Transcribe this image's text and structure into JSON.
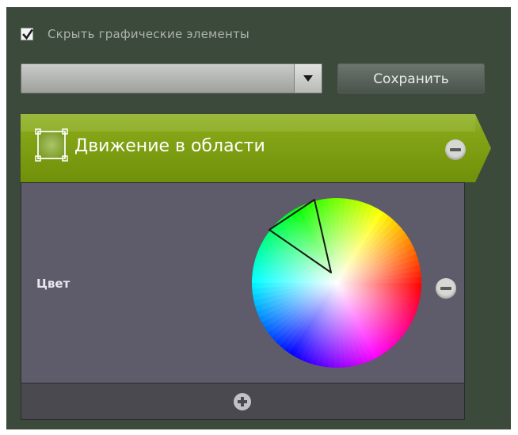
{
  "hide_graphics": {
    "label": "Скрыть графические элементы",
    "checked": true
  },
  "preset_dropdown": {
    "value": ""
  },
  "save_button": {
    "label": "Сохранить"
  },
  "detector": {
    "title": "Движение в области",
    "icon": "zone-rectangle-icon",
    "accent_color": "#7e9e12"
  },
  "parameter": {
    "label": "Цвет",
    "control": "color-wheel"
  },
  "icons": {
    "remove": "minus-circle-icon",
    "add": "plus-circle-icon"
  }
}
